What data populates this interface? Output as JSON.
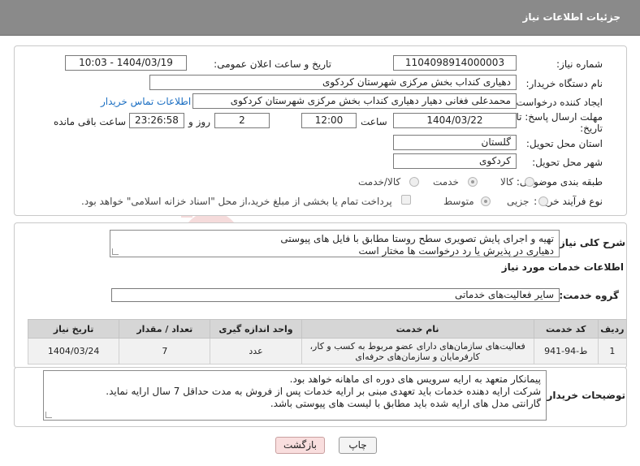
{
  "header": {
    "title": "جزئیات اطلاعات نیاز"
  },
  "watermark": {
    "text": "AriaTender.neT"
  },
  "form": {
    "need_number": {
      "label": "شماره نیاز:",
      "value": "1104098914000003"
    },
    "announce_datetime": {
      "label": "تاریخ و ساعت اعلان عمومی:",
      "value": "1404/03/19 - 10:03"
    },
    "buyer_org": {
      "label": "نام دستگاه خریدار:",
      "value": "دهیاری کنداب بخش مرکزی شهرستان کردکوی"
    },
    "requester": {
      "label": "ایجاد کننده درخواست:",
      "value": "محمدعلی فغانی دهیار دهیاری کنداب بخش مرکزی شهرستان کردکوی",
      "contact_link": "اطلاعات تماس خریدار"
    },
    "deadline": {
      "label_line1": "مهلت ارسال پاسخ: تا",
      "label_line2": "تاریخ:",
      "date": "1404/03/22",
      "time_label": "ساعت",
      "time": "12:00",
      "days": "2",
      "days_label": "روز و",
      "remaining": "23:26:58",
      "remaining_label": "ساعت باقی مانده"
    },
    "province": {
      "label": "استان محل تحویل:",
      "value": "گلستان"
    },
    "city": {
      "label": "شهر محل تحویل:",
      "value": "کردکوی"
    },
    "category": {
      "label": "طبقه بندی موضوعی:",
      "options": [
        "کالا",
        "خدمت",
        "کالا/خدمت"
      ],
      "selected_index": 1
    },
    "purchase_type": {
      "label": "نوع فرآیند خرید :",
      "options": [
        "جزیی",
        "متوسط"
      ],
      "selected_index": 1,
      "payment_note": "پرداخت تمام یا بخشی از مبلغ خرید،از محل \"اسناد خزانه اسلامی\" خواهد بود."
    }
  },
  "summary": {
    "label": "شرح کلی نیاز:",
    "lines": [
      "تهیه و اجرای پایش تصویری سطح روستا مطابق با فایل های پیوستی",
      "دهیاری در پذیرش یا رد درخواست ها مختار است"
    ]
  },
  "services": {
    "section_title": "اطلاعات خدمات مورد نیاز",
    "group_label": "گروه خدمت:",
    "group_value": "سایر فعالیت‌های خدماتی",
    "columns": [
      "ردیف",
      "کد خدمت",
      "نام خدمت",
      "واحد اندازه گیری",
      "تعداد / مقدار",
      "تاریخ نیاز"
    ],
    "rows": [
      {
        "row": "1",
        "code": "ط-94-941",
        "name_line1": "فعالیت‌های سازمان‌های دارای عضو مربوط به کسب و کار،",
        "name_line2": "کارفرمایان و سازمان‌های حرفه‌ای",
        "unit": "عدد",
        "qty": "7",
        "date": "1404/03/24"
      }
    ]
  },
  "buyer_notes": {
    "label": "توضیحات خریدار:",
    "lines": [
      "پیمانکار متعهد به ارایه سرویس های دوره ای ماهانه خواهد بود.",
      "شرکت ارایه دهنده خدمات باید تعهدی مبنی بر ارایه خدمات پس از فروش به مدت حداقل 7 سال ارایه نماید.",
      "گارانتی مدل های ارایه شده باید مطابق با لیست های پیوستی باشد."
    ]
  },
  "buttons": {
    "print": "چاپ",
    "back": "بازگشت"
  },
  "colors": {
    "header_bg": "#8a8a8a",
    "back_button_bg": "#f9dede",
    "link": "#1a6ec2"
  }
}
